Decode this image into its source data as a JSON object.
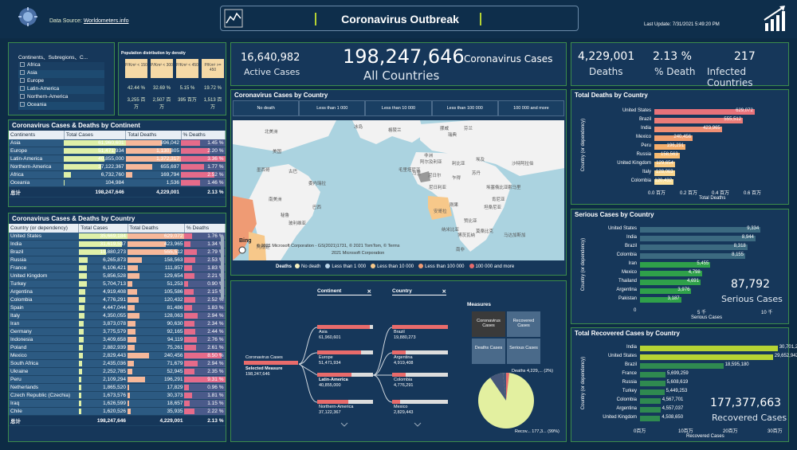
{
  "header": {
    "source_label": "Data Source:",
    "source_link": "Worldometers.info",
    "title": "Coronavirus Outbreak",
    "last_update": "Last Update: 7/31/2021 5:49:20 PM"
  },
  "filter": {
    "title": "Continents、Subregions、C...",
    "items": [
      "Africa",
      "Asia",
      "Europe",
      "Latin-America",
      "Northern-America",
      "Oceania"
    ]
  },
  "density": {
    "title": "Population distribution by density",
    "cols": [
      "P/Km² < 150",
      "P/Km² < 300",
      "P/Km² < 450",
      "P/Km² >= 450"
    ],
    "pct": [
      "42.44 %",
      "32.69 %",
      "5.15 %",
      "19.72 %"
    ],
    "vals": [
      "3,255 百万",
      "2,507 百万",
      "395 百万",
      "1,513 百万"
    ]
  },
  "kpi": {
    "active": "16,640,982",
    "active_label": "Active Cases",
    "total": "198,247,646",
    "total_label": "Coronavirus Cases",
    "countries_label": "All Countries",
    "deaths": "4,229,001",
    "deaths_label": "Deaths",
    "pct_death": "2.13 %",
    "pct_death_label": "% Death",
    "infected": "217",
    "infected_label": "Infected Countries"
  },
  "continent_table": {
    "title": "Coronavirus Cases & Deaths by Continent",
    "headers": [
      "Continents",
      "Total Cases",
      "Total Deaths",
      "% Deaths"
    ],
    "rows": [
      [
        "Asia",
        "61,960,601",
        "896,042",
        "1.45 %"
      ],
      [
        "Europe",
        "51,471,934",
        "1,130,805",
        "2.20 %"
      ],
      [
        "Latin-America",
        "40,855,000",
        "1,372,317",
        "3.36 %"
      ],
      [
        "Northern-America",
        "37,122,367",
        "655,697",
        "1.77 %"
      ],
      [
        "Africa",
        "6,732,760",
        "169,794",
        "2.52 %"
      ],
      [
        "Oceania",
        "104,984",
        "1,536",
        "1.46 %"
      ]
    ],
    "total": [
      "总计",
      "198,247,646",
      "4,229,001",
      "2.13 %"
    ]
  },
  "country_table": {
    "title": "Coronavirus Cases & Deaths by Country",
    "headers": [
      "Country (or dependency)",
      "Total Cases",
      "Total Deaths",
      "% Deaths"
    ],
    "rows": [
      [
        "United States",
        "35,669,184",
        "629,072",
        "1.76 %"
      ],
      [
        "India",
        "31,619,537",
        "423,965",
        "1.34 %"
      ],
      [
        "Brazil",
        "19,880,273",
        "555,512",
        "2.79 %"
      ],
      [
        "Russia",
        "6,265,873",
        "158,563",
        "2.53 %"
      ],
      [
        "France",
        "6,106,421",
        "111,857",
        "1.83 %"
      ],
      [
        "United Kingdom",
        "5,856,528",
        "129,654",
        "2.21 %"
      ],
      [
        "Turkey",
        "5,704,713",
        "51,253",
        "0.90 %"
      ],
      [
        "Argentina",
        "4,919,408",
        "105,586",
        "2.15 %"
      ],
      [
        "Colombia",
        "4,776,291",
        "120,432",
        "2.52 %"
      ],
      [
        "Spain",
        "4,447,044",
        "81,486",
        "1.83 %"
      ],
      [
        "Italy",
        "4,350,055",
        "128,063",
        "2.94 %"
      ],
      [
        "Iran",
        "3,873,078",
        "90,630",
        "2.34 %"
      ],
      [
        "Germany",
        "3,775,579",
        "92,165",
        "2.44 %"
      ],
      [
        "Indonesia",
        "3,409,658",
        "94,119",
        "2.76 %"
      ],
      [
        "Poland",
        "2,882,939",
        "75,261",
        "2.61 %"
      ],
      [
        "Mexico",
        "2,829,443",
        "240,456",
        "8.50 %"
      ],
      [
        "South Africa",
        "2,435,036",
        "71,679",
        "2.94 %"
      ],
      [
        "Ukraine",
        "2,252,785",
        "52,945",
        "2.35 %"
      ],
      [
        "Peru",
        "2,109,294",
        "196,291",
        "9.31 %"
      ],
      [
        "Netherlands",
        "1,865,520",
        "17,829",
        "0.96 %"
      ],
      [
        "Czech Republic (Czechia)",
        "1,673,576",
        "30,373",
        "1.81 %"
      ],
      [
        "Iraq",
        "1,626,599",
        "18,657",
        "1.15 %"
      ],
      [
        "Chile",
        "1,620,526",
        "35,935",
        "2.22 %"
      ]
    ],
    "total": [
      "总计",
      "198,247,646",
      "4,229,001",
      "2.13 %"
    ]
  },
  "map": {
    "title": "Coronavirus Cases by Country",
    "filters": [
      "No death",
      "Less than 1 000",
      "Less than 10 000",
      "Less than 100 000",
      "100 000 and more"
    ],
    "labels": [
      "格陵兰",
      "冰岛",
      "挪威",
      "瑞典",
      "芬兰",
      "北美洲",
      "美国",
      "墨西哥",
      "古巴",
      "委内瑞拉",
      "秘鲁",
      "巴西",
      "南美洲",
      "玻利维亚",
      "阿根廷",
      "非洲",
      "尼日尔",
      "乍得",
      "苏丹",
      "埃塞俄比亚",
      "刚果",
      "坦桑尼亚",
      "安哥拉",
      "赞比亚",
      "纳米比亚",
      "博茨瓦纳",
      "南非",
      "马达加斯加",
      "毛里塔尼亚",
      "马里",
      "尼日利亚",
      "利比亚",
      "埃及",
      "沙特阿拉伯",
      "阿尔及利亚",
      "肯尼亚",
      "索马里",
      "莫桑比克"
    ],
    "copyright": "© 2021 Microsoft Corporation - GS(2021)1731, © 2021 TomTom, © Terms",
    "copyright2": "2021 Microsoft Corporation",
    "bing": "Bing",
    "legend_title": "Deaths",
    "legend": [
      "No death",
      "Less than 1 000",
      "Less than 10 000",
      "Less than 100 000",
      "100 000 and more"
    ]
  },
  "tree": {
    "col1": "Continent",
    "col2": "Country",
    "root_label": "Coronavirus Cases",
    "root_sub": "Selected Measure",
    "root_val": "198,247,646",
    "cont": [
      [
        "Asia",
        "61,960,601"
      ],
      [
        "Europe",
        "51,471,934"
      ],
      [
        "Latin-America",
        "40,855,000"
      ],
      [
        "Northern-America",
        "37,122,367"
      ]
    ],
    "countries": [
      [
        "Brazil",
        "19,880,273"
      ],
      [
        "Argentina",
        "4,919,408"
      ],
      [
        "Colombia",
        "4,776,291"
      ],
      [
        "Mexico",
        "2,829,443"
      ]
    ],
    "measures_title": "Measures",
    "measures": [
      "Coronavirus Cases",
      "Recovered Cases",
      "Deaths Cases",
      "Serious Cases"
    ],
    "pie_deaths": "Deaths 4,229,... (2%)",
    "pie_recov": "Recov... 177,3... (99%)"
  },
  "deaths_chart": {
    "title": "Total Deaths by Country",
    "ylabel": "Country (or dependency)",
    "xlabel": "Total Deaths",
    "ticks": [
      "0.0 百万",
      "0.2 百万",
      "0.4 百万",
      "0.6 百万"
    ]
  },
  "serious_chart": {
    "title": "Serious Cases by Country",
    "ylabel": "Country (or dependency)",
    "xlabel": "Serious Cases",
    "ticks": [
      "0",
      "5 千",
      "10 千"
    ],
    "big": "87,792",
    "big_label": "Serious Cases"
  },
  "recovered_chart": {
    "title": "Total Recovered Cases by Country",
    "ylabel": "Country (or dependency)",
    "xlabel": "Recovered Cases",
    "ticks": [
      "0百万",
      "10百万",
      "20百万",
      "30百万"
    ],
    "big": "177,377,663",
    "big_label": "Recovered Cases"
  },
  "chart_data": [
    {
      "type": "bar",
      "title": "Total Deaths by Country",
      "categories": [
        "United States",
        "Brazil",
        "India",
        "Mexico",
        "Peru",
        "Russia",
        "United Kingdom",
        "Italy",
        "Colombia"
      ],
      "values": [
        629072,
        555512,
        423965,
        240456,
        196291,
        158563,
        129654,
        128063,
        120432
      ],
      "xlabel": "Total Deaths",
      "ylabel": "Country (or dependency)"
    },
    {
      "type": "bar",
      "title": "Serious Cases by Country",
      "categories": [
        "United States",
        "India",
        "Brazil",
        "Colombia",
        "Iran",
        "Mexico",
        "Thailand",
        "Argentina",
        "Pakistan"
      ],
      "values": [
        9334,
        8944,
        8318,
        8155,
        5455,
        4798,
        4691,
        3976,
        3187
      ],
      "xlabel": "Serious Cases",
      "ylabel": "Country (or dependency)"
    },
    {
      "type": "bar",
      "title": "Total Recovered Cases by Country",
      "categories": [
        "India",
        "United States",
        "Brazil",
        "France",
        "Russia",
        "Turkey",
        "Colombia",
        "Argentina",
        "United Kingdom"
      ],
      "values": [
        30701203,
        29652942,
        18595180,
        5699259,
        5608619,
        5449253,
        4567701,
        4557037,
        4508650
      ],
      "xlabel": "Recovered Cases",
      "ylabel": "Country (or dependency)"
    },
    {
      "type": "pie",
      "title": "",
      "categories": [
        "Deaths",
        "Recovered"
      ],
      "values": [
        4229001,
        177377663
      ]
    }
  ]
}
